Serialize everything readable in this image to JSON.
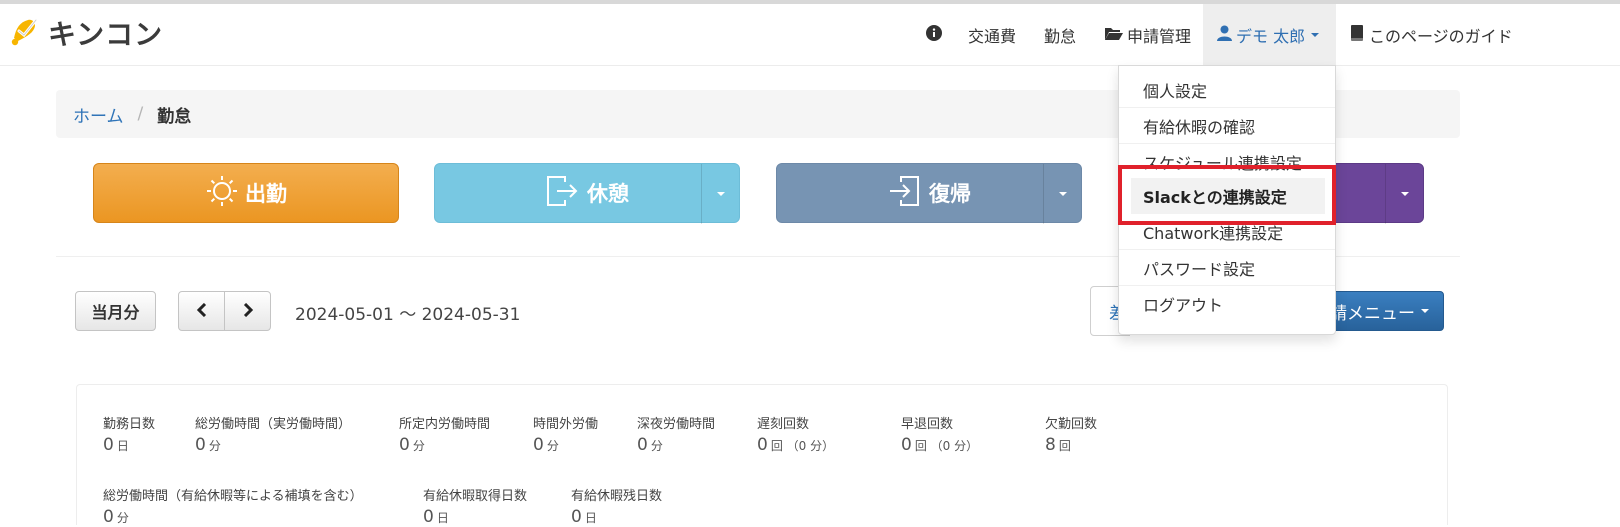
{
  "brand": {
    "name": "キンコン",
    "logo_icon": "bell-check-icon",
    "logo_color": "#f7b500"
  },
  "nav": {
    "info_icon": "info-circle-icon",
    "transport": "交通費",
    "attendance": "勤怠",
    "applications": "申請管理",
    "user": "デモ 太郎",
    "guide": "このページのガイド"
  },
  "breadcrumb": {
    "home": "ホーム",
    "separator": "/",
    "current": "勤怠"
  },
  "punch_buttons": {
    "start": "出勤",
    "break": "休憩",
    "return": "復帰"
  },
  "toolbar": {
    "current_month": "当月分",
    "date_range": "2024-05-01 〜 2024-05-31",
    "partial_label": "差",
    "apply_menu": "請メニュー"
  },
  "stats": {
    "row1": [
      {
        "label": "勤務日数",
        "value": "0",
        "unit": "日"
      },
      {
        "label": "総労働時間（実労働時間）",
        "value": "0",
        "unit": "分"
      },
      {
        "label": "所定内労働時間",
        "value": "0",
        "unit": "分"
      },
      {
        "label": "時間外労働",
        "value": "0",
        "unit": "分"
      },
      {
        "label": "深夜労働時間",
        "value": "0",
        "unit": "分"
      },
      {
        "label": "遅刻回数",
        "value": "0",
        "unit": "回 （0 分）"
      },
      {
        "label": "早退回数",
        "value": "0",
        "unit": "回 （0 分）"
      },
      {
        "label": "欠勤回数",
        "value": "8",
        "unit": "回"
      }
    ],
    "row2": [
      {
        "label": "総労働時間（有給休暇等による補填を含む）",
        "value": "0",
        "unit": "分"
      },
      {
        "label": "有給休暇取得日数",
        "value": "0",
        "unit": "日"
      },
      {
        "label": "有給休暇残日数",
        "value": "0",
        "unit": "日"
      }
    ]
  },
  "dropdown": {
    "items": [
      "個人設定",
      "有給休暇の確認",
      "スケジュール連携設定",
      "Slackとの連携設定",
      "Chatwork連携設定",
      "パスワード設定",
      "ログアウト"
    ],
    "active_index": 3
  },
  "colors": {
    "start": "#ef9f2e",
    "break": "#78c8e2",
    "return": "#7794b3",
    "end": "#6b4599",
    "highlight": "#e0212b",
    "link": "#2f74b8"
  }
}
